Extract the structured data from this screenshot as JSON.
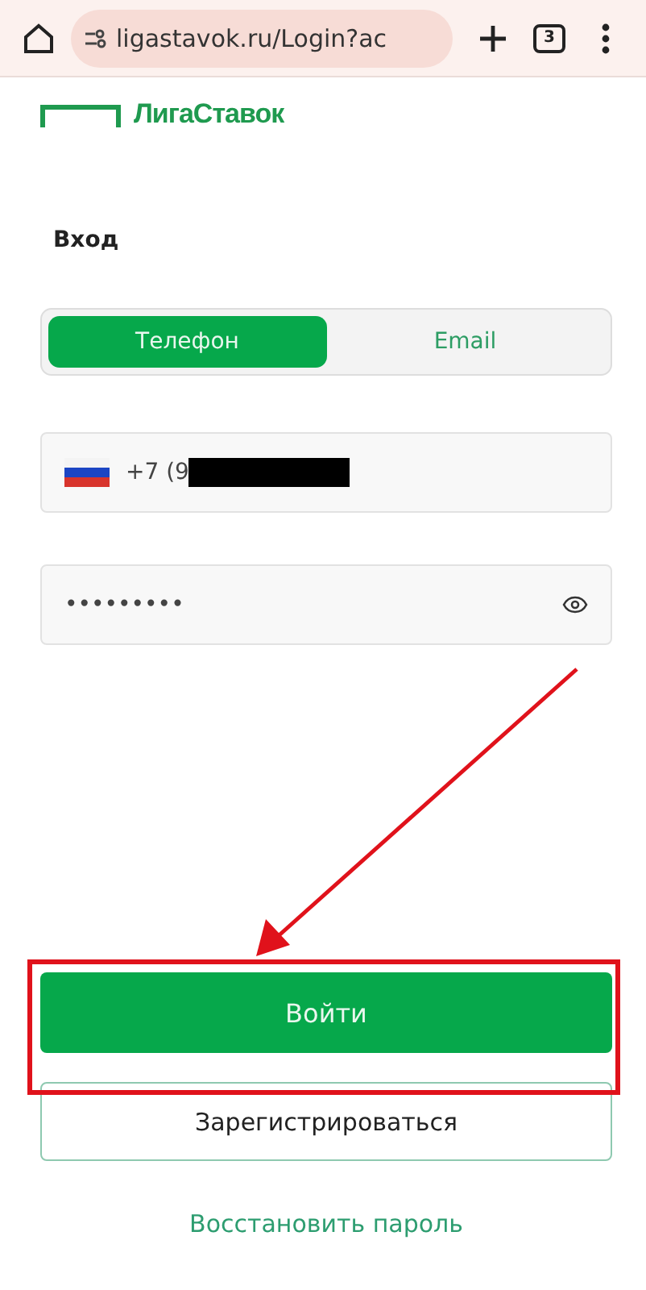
{
  "browser": {
    "url": "ligastavok.ru/Login?ac",
    "tab_count": "3"
  },
  "logo": {
    "text": "ЛигаСтавок"
  },
  "heading": "Вход",
  "tabs": [
    {
      "label": "Телефон",
      "selected": true
    },
    {
      "label": "Email",
      "selected": false
    }
  ],
  "phone": {
    "value": "+7 (9"
  },
  "password": {
    "value": "•••••••••"
  },
  "buttons": {
    "login": "Войти",
    "register": "Зарегистрироваться"
  },
  "restore_link": "Восстановить пароль"
}
